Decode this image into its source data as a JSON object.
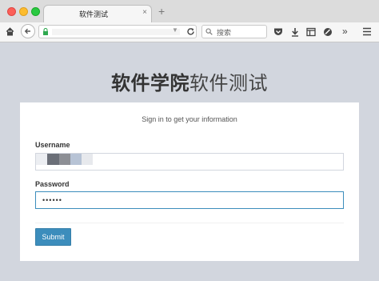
{
  "browser": {
    "tab_title": "软件测试",
    "tab_close": "×",
    "new_tab": "+",
    "search_placeholder": "搜索"
  },
  "page": {
    "heading_bold": "软件学院",
    "heading_light": "软件测试",
    "card_title": "Sign in to get your information",
    "username_label": "Username",
    "password_label": "Password",
    "password_value": "••••••",
    "submit_label": "Submit"
  },
  "colors": {
    "primary": "#3c8dbc",
    "page_bg": "#d2d6de"
  }
}
